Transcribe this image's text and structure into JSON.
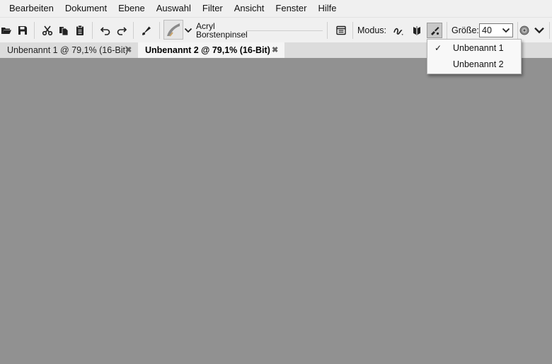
{
  "menu": [
    "Bearbeiten",
    "Dokument",
    "Ebene",
    "Auswahl",
    "Filter",
    "Ansicht",
    "Fenster",
    "Hilfe"
  ],
  "toolbar": {
    "brush_name_line1": "Acryl",
    "brush_name_line2": "Borstenpinsel",
    "mode_label": "Modus:",
    "size_label": "Größe:",
    "size_value": "40"
  },
  "tabs": [
    {
      "label": "Unbenannt 1 @ 79,1% (16-Bit)",
      "close": "✖"
    },
    {
      "label": "Unbenannt 2 @ 79,1% (16-Bit)",
      "close": "✖",
      "active": true
    }
  ],
  "popup": {
    "items": [
      {
        "label": "Unbenannt 1",
        "checked": true,
        "check": "✓"
      },
      {
        "label": "Unbenannt 2",
        "checked": false
      }
    ]
  },
  "colors": {
    "canvas": "#919191",
    "chrome": "#f0f0f0",
    "tabbar": "#dcdcdc"
  }
}
